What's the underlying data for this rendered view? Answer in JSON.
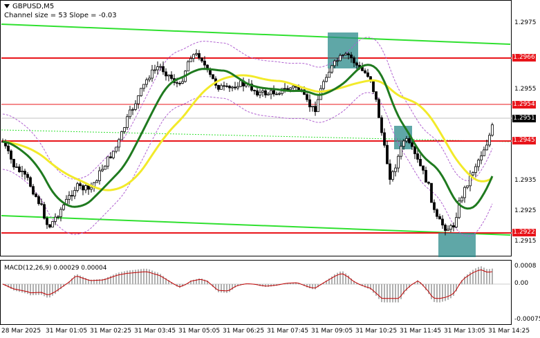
{
  "header": {
    "symbol": "GBPUSD,M5",
    "subtitle": "Channel size = 53 Slope = -0.03"
  },
  "macd": {
    "label": "MACD(12,26,9) 0.00029 0.00004",
    "axis_ticks": [
      "0.0008",
      "0.00",
      "-0.00075"
    ]
  },
  "price_axis": {
    "ticks": [
      "1.2975",
      "1.2955",
      "1.2935",
      "1.2925",
      "1.2915"
    ],
    "tags": [
      {
        "label": "1.2966",
        "color": "#e8141a",
        "kind": "resistance"
      },
      {
        "label": "1.2954",
        "color": "#e8141a",
        "kind": "level"
      },
      {
        "label": "1.2951",
        "color": "#000000",
        "kind": "current-price"
      },
      {
        "label": "1.2945",
        "color": "#e8141a",
        "kind": "level"
      },
      {
        "label": "1.2922",
        "color": "#e8141a",
        "kind": "support"
      }
    ]
  },
  "time_axis": {
    "labels": [
      "28 Mar 2025",
      "31 Mar 01:05",
      "31 Mar 02:25",
      "31 Mar 03:45",
      "31 Mar 05:05",
      "31 Mar 06:25",
      "31 Mar 07:45",
      "31 Mar 09:05",
      "31 Mar 10:25",
      "31 Mar 11:45",
      "31 Mar 13:05",
      "31 Mar 14:25"
    ]
  },
  "colors": {
    "background": "#ffffff",
    "candles": "#000000",
    "ma_fast": "#1f7a1f",
    "ma_slow": "#f2ea2a",
    "channel": "#2fe02f",
    "levels": "#e8141a",
    "bands": "#b060d0",
    "highlight_box": "#2a8a8a",
    "macd_hist": "#b0b0b0",
    "macd_signal": "#c00000"
  },
  "icons": {
    "menu": "dropdown-arrow-icon"
  }
}
